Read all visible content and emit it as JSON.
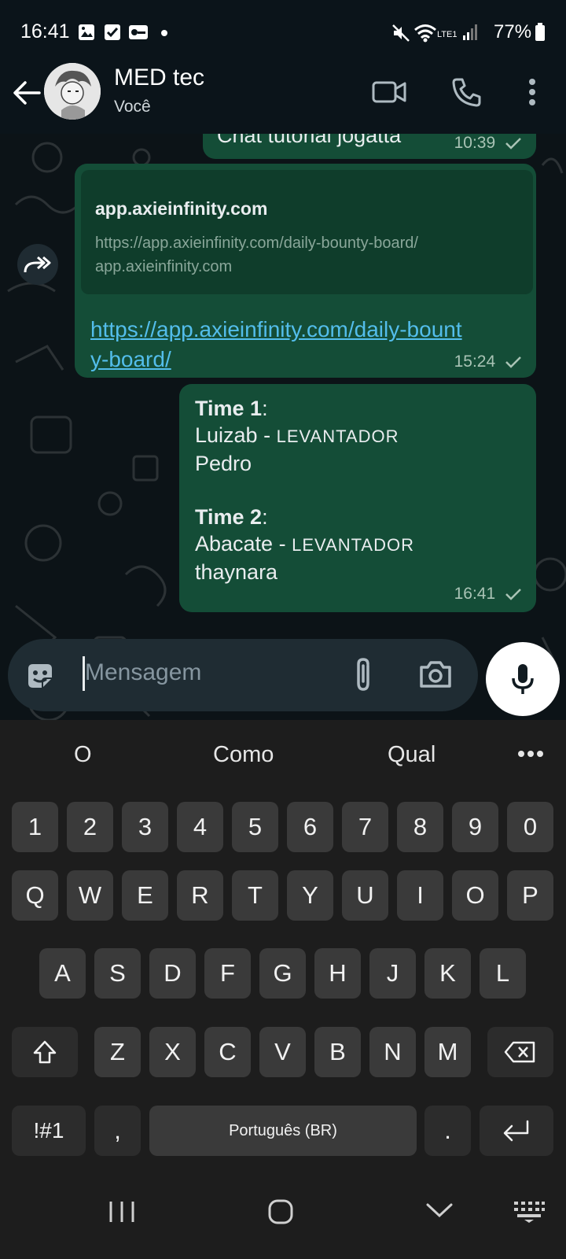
{
  "status_bar": {
    "time": "16:41",
    "battery": "77%",
    "network": "LTE1"
  },
  "header": {
    "contact_name": "MED tec",
    "subtitle": "Você"
  },
  "messages": {
    "partial": {
      "text": "Chat tutorial jogatta",
      "time": "10:39"
    },
    "link_msg": {
      "preview_title": "app.axieinfinity.com",
      "preview_url": "https://app.axieinfinity.com/daily-bounty-board/",
      "preview_domain": "app.axieinfinity.com",
      "link": "https://app.axieinfinity.com/daily-bounty-board/",
      "time": "15:24"
    },
    "team_msg": {
      "team1_label": "Time 1",
      "team1_player1": "Luizab",
      "team1_role": "LEVANTADOR",
      "team1_player2": "Pedro",
      "team2_label": "Time 2",
      "team2_player1": "Abacate",
      "team2_role": "LEVANTADOR",
      "team2_player2": "thaynara",
      "time": "16:41"
    }
  },
  "composer": {
    "placeholder": "Mensagem"
  },
  "keyboard": {
    "suggestions": [
      "O",
      "Como",
      "Qual"
    ],
    "row_numbers": [
      "1",
      "2",
      "3",
      "4",
      "5",
      "6",
      "7",
      "8",
      "9",
      "0"
    ],
    "row1": [
      "Q",
      "W",
      "E",
      "R",
      "T",
      "Y",
      "U",
      "I",
      "O",
      "P"
    ],
    "row2": [
      "A",
      "S",
      "D",
      "F",
      "G",
      "H",
      "J",
      "K",
      "L"
    ],
    "row3": [
      "Z",
      "X",
      "C",
      "V",
      "B",
      "N",
      "M"
    ],
    "symbols_key": "!#1",
    "comma_key": ",",
    "space_label": "Português (BR)",
    "period_key": "."
  },
  "colors": {
    "bubble": "#144d37",
    "link": "#53bdeb",
    "background": "#0b141a"
  }
}
